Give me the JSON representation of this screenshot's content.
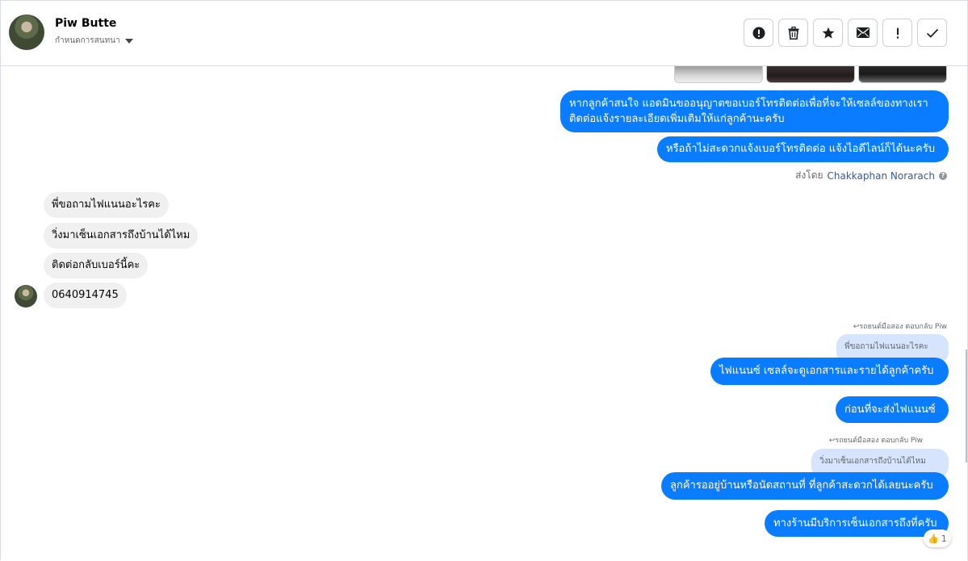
{
  "header": {
    "contact_name": "Piw Butte",
    "assign_label": "กำหนดการสนทนา",
    "actions": [
      {
        "name": "spam",
        "icon": "alert-circle-icon"
      },
      {
        "name": "delete",
        "icon": "trash-icon"
      },
      {
        "name": "star",
        "icon": "star-icon"
      },
      {
        "name": "mark-unread",
        "icon": "envelope-icon"
      },
      {
        "name": "follow-up",
        "icon": "exclamation-icon"
      },
      {
        "name": "mark-done",
        "icon": "check-icon"
      }
    ]
  },
  "messages": {
    "out_1": "หากลูกค้าสนใจ แอดมินขออนุญาตขอเบอร์โทรติดต่อเพื่อที่จะให้เซลล์ของทางเรา",
    "out_1b": "ติดต่อแจ้งรายละเอียดเพิ่มเติมให้แก่ลูกค้านะครับ",
    "out_2": "หรือถ้าไม่สะดวกแจ้งเบอร์โทรติดต่อ แจ้งไอดีไลน์ก็ได้นะครับ",
    "sent_by_prefix": "ส่งโดย",
    "sent_by_name": "Chakkaphan Norarach",
    "in_1": "พี่ขอถามไฟแนนอะไรคะ",
    "in_2": "วิ่งมาเซ็นเอกสารถึงบ้านได้ไหม",
    "in_3": "ติดต่อกลับเบอร์นี้คะ",
    "in_4": "0640914745",
    "reply_label_1": "รถยนต์มือสอง ตอบกลับ Piw",
    "quote_1": "พี่ขอถามไฟแนนอะไรคะ",
    "out_3": "ไฟแนนซ์ เซลล์จะดูเอกสารและรายได้ลูกค้าครับ",
    "out_4": "ก่อนที่จะส่งไฟแนนซ์",
    "reply_label_2": "รถยนต์มือสอง ตอบกลับ Piw",
    "quote_2": "วิ่งมาเซ็นเอกสารถึงบ้านได้ไหม",
    "out_5": "ลูกค้ารออยู่บ้านหรือนัดสถานที่ ที่ลูกค้าสะดวกได้เลยนะครับ",
    "out_6": "ทางร้านมีบริการเซ็นเอกสารถึงที่ครับ",
    "reaction_emoji": "👍",
    "reaction_count": "1"
  },
  "colors": {
    "outgoing_bubble": "#0a7cff",
    "incoming_bubble": "#f0f0f0",
    "quote_bubble": "#d6e5fd"
  }
}
